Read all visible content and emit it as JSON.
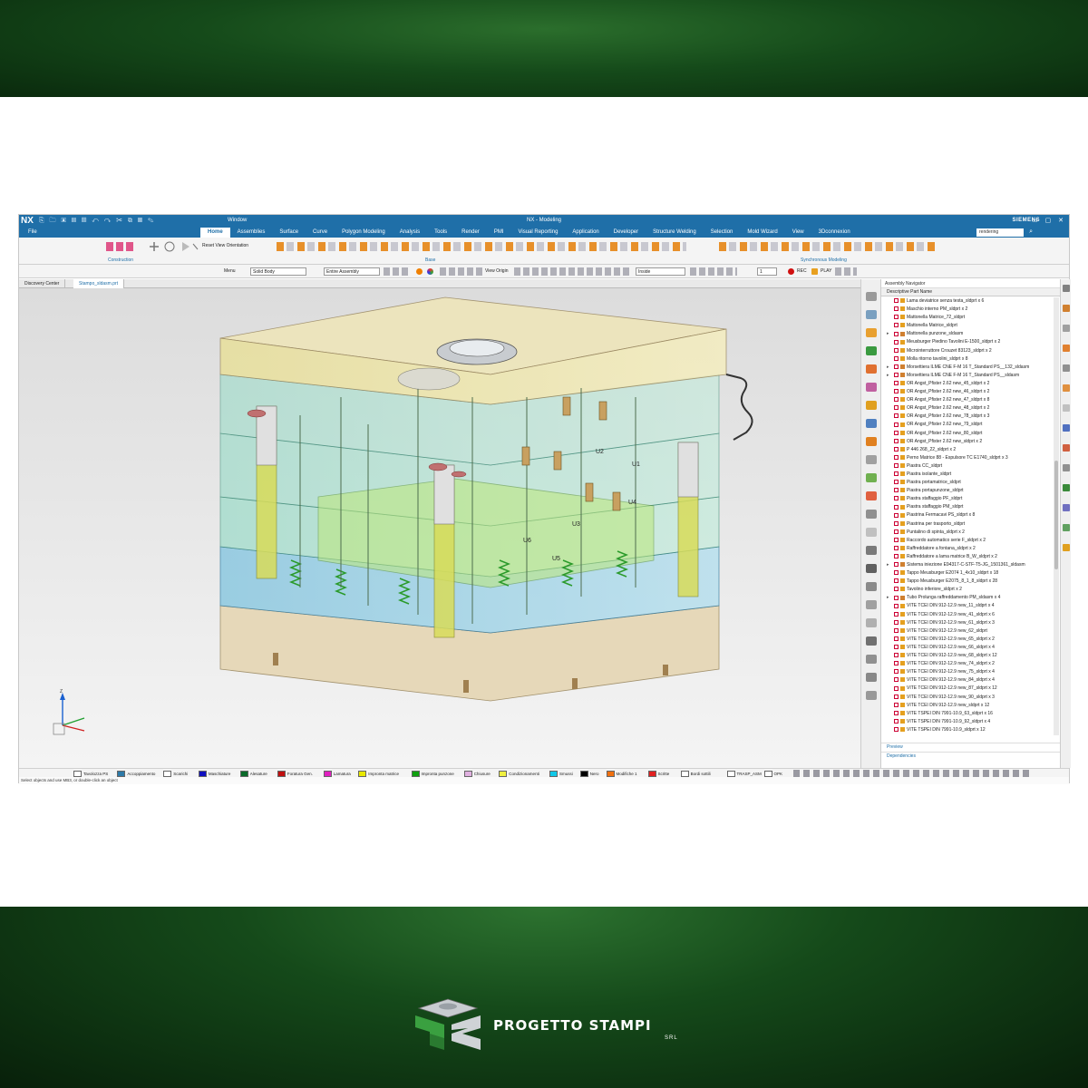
{
  "window": {
    "app": "NX",
    "window_menu": "Window",
    "title": "NX - Modeling",
    "brand": "SIEMENS"
  },
  "menu": {
    "file": "File",
    "tabs": [
      "Home",
      "Assemblies",
      "Surface",
      "Curve",
      "Polygon Modeling",
      "Analysis",
      "Tools",
      "Render",
      "PMI",
      "Visual Reporting",
      "Application",
      "Developer",
      "Structure Welding",
      "Selection",
      "Mold Wizard",
      "View",
      "3Dconnexion"
    ],
    "active_tab": "Home",
    "search_value": "rendering"
  },
  "ribbon": {
    "reset_view": "Reset View Orientation",
    "groups": [
      "Construction",
      "Base",
      "Synchronous Modeling"
    ]
  },
  "toolbar": {
    "menu": "Menu",
    "filter": "Solid Body",
    "scope": "Entire Assembly",
    "view_origin": "View Origin",
    "inside": "Inside",
    "number": "1",
    "rec": "REC",
    "play": "PLAY"
  },
  "doc_tabs": [
    "Discovery Center",
    "Stampo_sldasm.prt"
  ],
  "navigator": {
    "title": "Assembly Navigator",
    "column": "Descriptive Part Name",
    "items": [
      {
        "label": "Lama deviatrice senza testa_sldprt x 6",
        "asm": false
      },
      {
        "label": "Maschio interno PM_sldprt x 2",
        "asm": false
      },
      {
        "label": "Mattonella Matrice_72_sldprt",
        "asm": false
      },
      {
        "label": "Mattonella Matrice_sldprt",
        "asm": false
      },
      {
        "label": "Mattonella punzone_sldasm",
        "asm": true
      },
      {
        "label": "Meusburger Piedino Tavolini E-1500_sldprt x 2",
        "asm": false
      },
      {
        "label": "Microinterruttore Crouzet 83123_sldprt x 2",
        "asm": false
      },
      {
        "label": "Molla ritorno tavolini_sldprt x 8",
        "asm": false
      },
      {
        "label": "Morsettiera ILME CNE F-M 16 T_Standard PS__132_sldasm",
        "asm": true
      },
      {
        "label": "Morsettiera ILME CNE F-M 16 T_Standard PS__sldasm",
        "asm": true
      },
      {
        "label": "OR Angst_Pfister 2.62 new_45_sldprt x 2",
        "asm": false
      },
      {
        "label": "OR Angst_Pfister 2.62 new_46_sldprt x 2",
        "asm": false
      },
      {
        "label": "OR Angst_Pfister 2.62 new_47_sldprt x 8",
        "asm": false
      },
      {
        "label": "OR Angst_Pfister 2.62 new_48_sldprt x 2",
        "asm": false
      },
      {
        "label": "OR Angst_Pfister 2.62 new_78_sldprt x 3",
        "asm": false
      },
      {
        "label": "OR Angst_Pfister 2.62 new_79_sldprt",
        "asm": false
      },
      {
        "label": "OR Angst_Pfister 2.62 new_80_sldprt",
        "asm": false
      },
      {
        "label": "OR Angst_Pfister 2.62 new_sldprt x 2",
        "asm": false
      },
      {
        "label": "P 446 268_22_sldprt x 2",
        "asm": false
      },
      {
        "label": "Perno Matrice 88 - Espulsore TC E1740_sldprt x 3",
        "asm": false
      },
      {
        "label": "Piastra CC_sldprt",
        "asm": false
      },
      {
        "label": "Piastra isolante_sldprt",
        "asm": false
      },
      {
        "label": "Piastra portamatrice_sldprt",
        "asm": false
      },
      {
        "label": "Piastra portapunzone_sldprt",
        "asm": false
      },
      {
        "label": "Piastra staffaggio PF_sldprt",
        "asm": false
      },
      {
        "label": "Piastra staffaggio PM_sldprt",
        "asm": false
      },
      {
        "label": "Piastrina Fermacavi PS_sldprt x 8",
        "asm": false
      },
      {
        "label": "Piastrina per trasporto_sldprt",
        "asm": false
      },
      {
        "label": "Puntalino di spinta_sldprt x 2",
        "asm": false
      },
      {
        "label": "Raccordo automatico serie F_sldprt x 2",
        "asm": false
      },
      {
        "label": "Raffreddatore a fontana_sldprt x 2",
        "asm": false
      },
      {
        "label": "Raffreddatore a lama matrice B_W_sldprt x 2",
        "asm": false
      },
      {
        "label": "Sistema iniezione E94317-C-STF-T5-JG_1501361_sldasm",
        "asm": true
      },
      {
        "label": "Tappo Meusburger E2074 1_4x10_sldprt x 18",
        "asm": false
      },
      {
        "label": "Tappo Meusburger E2075_8_1_8_sldprt x 28",
        "asm": false
      },
      {
        "label": "Tavolino inferiore_sldprt x 2",
        "asm": false
      },
      {
        "label": "Tubo Prolunga raffreddamento PM_sldasm x 4",
        "asm": true
      },
      {
        "label": "VITE TCEI DIN 912-12.9 new_11_sldprt x 4",
        "asm": false
      },
      {
        "label": "VITE TCEI DIN 912-12.9 new_41_sldprt x 6",
        "asm": false
      },
      {
        "label": "VITE TCEI DIN 912-12.9 new_61_sldprt x 3",
        "asm": false
      },
      {
        "label": "VITE TCEI DIN 912-12.9 new_62_sldprt",
        "asm": false
      },
      {
        "label": "VITE TCEI DIN 912-12.9 new_65_sldprt x 2",
        "asm": false
      },
      {
        "label": "VITE TCEI DIN 912-12.9 new_66_sldprt x 4",
        "asm": false
      },
      {
        "label": "VITE TCEI DIN 912-12.9 new_68_sldprt x 12",
        "asm": false
      },
      {
        "label": "VITE TCEI DIN 912-12.9 new_74_sldprt x 2",
        "asm": false
      },
      {
        "label": "VITE TCEI DIN 912-12.9 new_75_sldprt x 4",
        "asm": false
      },
      {
        "label": "VITE TCEI DIN 912-12.9 new_84_sldprt x 4",
        "asm": false
      },
      {
        "label": "VITE TCEI DIN 912-12.9 new_87_sldprt x 12",
        "asm": false
      },
      {
        "label": "VITE TCEI DIN 912-12.9 new_90_sldprt x 3",
        "asm": false
      },
      {
        "label": "VITE TCEI DIN 912-12.9 new_sldprt x 12",
        "asm": false
      },
      {
        "label": "VITE TSPEI DIN 7991-10.9_63_sldprt x 16",
        "asm": false
      },
      {
        "label": "VITE TSPEI DIN 7991-10.9_92_sldprt x 4",
        "asm": false
      },
      {
        "label": "VITE TSPEI DIN 7991-10.9_sldprt x 12",
        "asm": false
      }
    ],
    "preview": "Preview",
    "dependencies": "Dependencies"
  },
  "viewport_labels": {
    "u1": "U1",
    "u2": "U2",
    "u3": "U3",
    "u4": "U4",
    "u5": "U5",
    "u6": "U6"
  },
  "layers": [
    {
      "label": "Tavolozza PS",
      "color": "#ffffff"
    },
    {
      "label": "Accoppiamento",
      "color": "#2e7aa8"
    },
    {
      "label": "Scarichi",
      "color": "#ffffff"
    },
    {
      "label": "Maschiature",
      "color": "#1010c0"
    },
    {
      "label": "Alesature",
      "color": "#0a6a2a"
    },
    {
      "label": "Foratura Gen.",
      "color": "#c01010"
    },
    {
      "label": "Lamatura",
      "color": "#e020c0"
    },
    {
      "label": "Impronta matrice",
      "color": "#e8e800"
    },
    {
      "label": "Impronta punzone",
      "color": "#10a010"
    },
    {
      "label": "Chiusure",
      "color": "#e0b0e0"
    },
    {
      "label": "Condizionamenti",
      "color": "#f0f040"
    },
    {
      "label": "Smussi",
      "color": "#10c8e8"
    },
    {
      "label": "Nero",
      "color": "#000000"
    },
    {
      "label": "Modifiche 1",
      "color": "#f07010"
    },
    {
      "label": "Scritte",
      "color": "#e02020"
    },
    {
      "label": "Bordi sottili",
      "color": "#ffffff"
    },
    {
      "label": "TRASP_ASM",
      "color": "#ffffff"
    },
    {
      "label": "OPK",
      "color": "#ffffff"
    }
  ],
  "status": "Select objects and use MB3, or double-click an object",
  "logo": {
    "name": "PROGETTO STAMPI",
    "suffix": "SRL"
  }
}
